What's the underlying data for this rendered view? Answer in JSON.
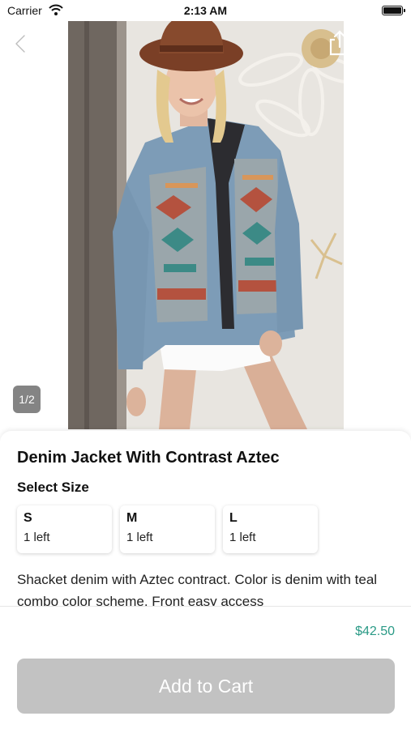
{
  "status_bar": {
    "carrier": "Carrier",
    "time": "2:13 AM",
    "battery_level": 1.0
  },
  "nav": {
    "back_icon": "chevron-left-icon",
    "share_icon": "share-icon",
    "cart_icon": "cart-icon"
  },
  "gallery": {
    "counter": "1/2",
    "current_image": 1,
    "total_images": 2
  },
  "product": {
    "title": "Denim Jacket With Contrast Aztec",
    "size_heading": "Select Size",
    "sizes": [
      {
        "label": "S",
        "stock": "1 left"
      },
      {
        "label": "M",
        "stock": "1 left"
      },
      {
        "label": "L",
        "stock": "1 left"
      }
    ],
    "description": "Shacket denim with Aztec contract.  Color is denim with teal combo color scheme.  Front easy access"
  },
  "footer": {
    "price": "$42.50",
    "add_to_cart_label": "Add to Cart"
  },
  "colors": {
    "price": "#2a9a86",
    "button_disabled": "#c2c2c2",
    "counter_bg": "#6e6e6e"
  }
}
